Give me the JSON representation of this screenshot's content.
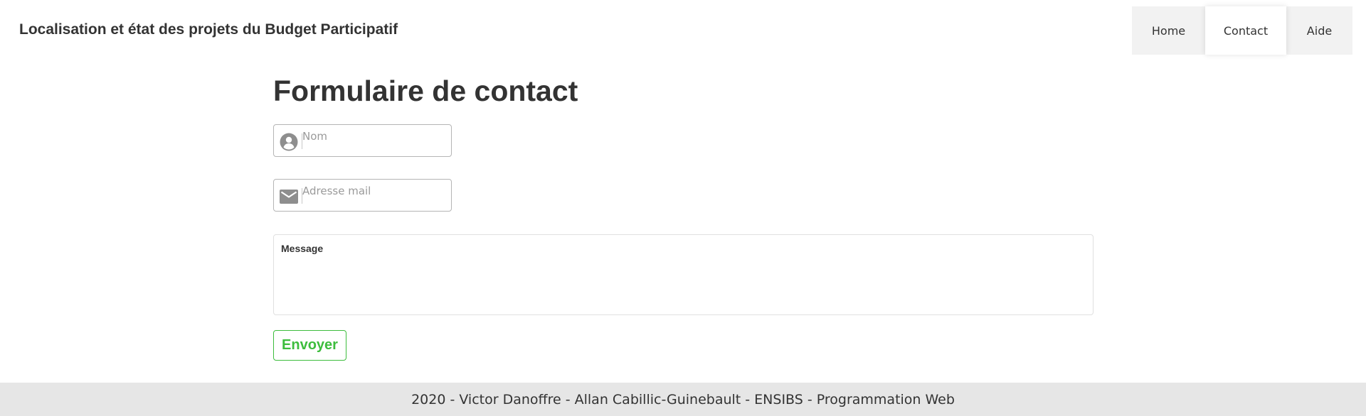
{
  "header": {
    "title": "Localisation et état des projets du Budget Participatif",
    "nav": {
      "home": "Home",
      "contact": "Contact",
      "aide": "Aide",
      "active": "Contact"
    }
  },
  "main": {
    "form_title": "Formulaire de contact",
    "fields": {
      "name": {
        "placeholder": "Nom",
        "value": "",
        "icon": "user-icon"
      },
      "email": {
        "placeholder": "Adresse mail",
        "value": "",
        "icon": "envelope-icon"
      },
      "message": {
        "label": "Message",
        "value": ""
      }
    },
    "submit_label": "Envoyer"
  },
  "footer": {
    "text": "2020 - Victor Danoffre - Allan Cabillic-Guinebault - ENSIBS - Programmation Web"
  },
  "colors": {
    "accent_green": "#3dbd3d",
    "footer_bg": "#e6e6e6",
    "nav_bg": "#f2f2f2",
    "text": "#333333",
    "icon_gray": "#8e8e8e"
  }
}
